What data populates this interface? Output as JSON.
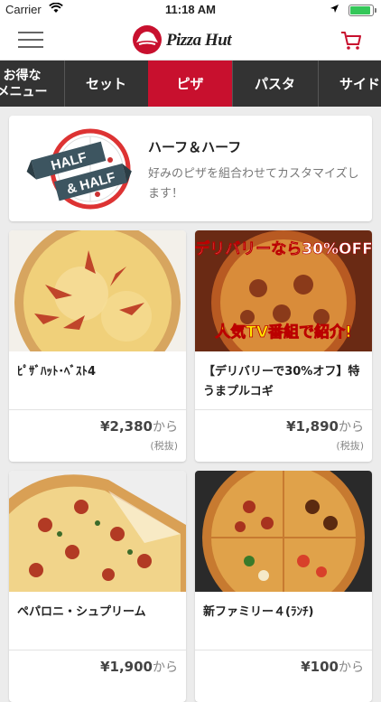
{
  "status_bar": {
    "carrier": "Carrier",
    "time": "11:18 AM",
    "battery_level": 0.9
  },
  "header": {
    "logo_text": "Pizza Hut",
    "brand_color": "#c8102e"
  },
  "tabs": [
    {
      "label_line1": "お得な",
      "label_line2": "メニュー",
      "active": false
    },
    {
      "label": "セット",
      "active": false
    },
    {
      "label": "ピザ",
      "active": true
    },
    {
      "label": "パスタ",
      "active": false
    },
    {
      "label": "サイド",
      "active": false
    }
  ],
  "half_half": {
    "badge_line1": "HALF",
    "badge_line2": "& HALF",
    "title": "ハーフ＆ハーフ",
    "description": "好みのピザを組合わせてカスタマイズします！"
  },
  "products": [
    {
      "name": "ﾋﾟｻﾞﾊｯﾄ･ﾍﾞｽﾄ4",
      "price": "¥2,380",
      "suffix": "から",
      "tax_note": "(税抜)",
      "image_icon": "pizza-best4-image"
    },
    {
      "name": "【デリバリーで30%オフ】特うまプルコギ",
      "price": "¥1,890",
      "suffix": "から",
      "tax_note": "(税抜)",
      "image_icon": "pizza-bulgogi-image",
      "banner_top": "デリバリーなら30%OFF",
      "banner_bottom": "人気TV番組で紹介!"
    },
    {
      "name": "ペパロニ・シュプリーム",
      "price": "¥1,900",
      "suffix": "から",
      "tax_note": "",
      "image_icon": "pizza-pepperoni-image"
    },
    {
      "name": "新ファミリー４(ﾗﾝﾁ)",
      "price": "¥100",
      "suffix": "から",
      "tax_note": "",
      "image_icon": "pizza-family4-image"
    }
  ]
}
